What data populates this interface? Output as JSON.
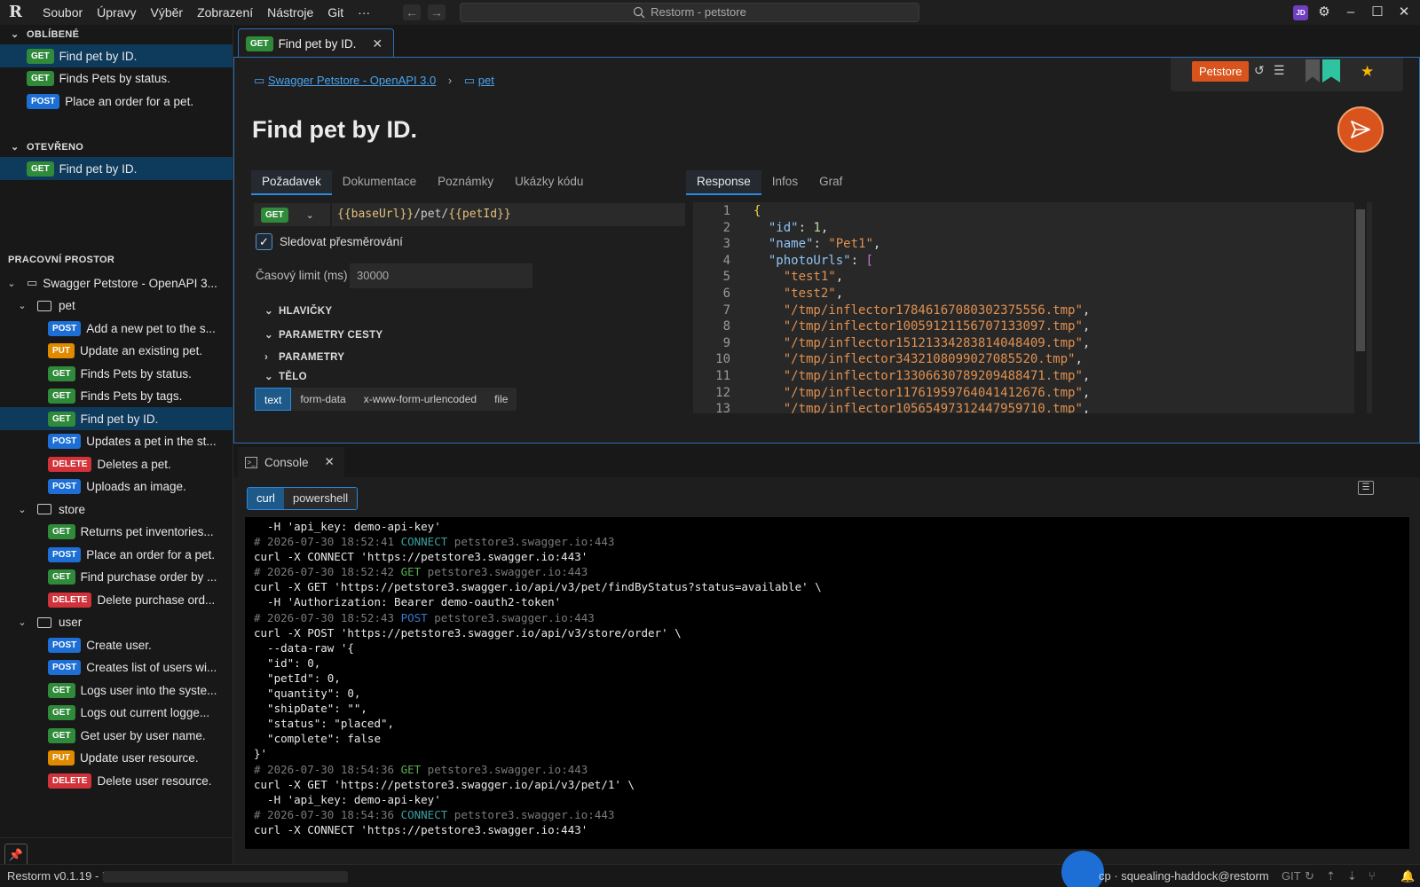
{
  "app": {
    "title": "Restorm - petstore",
    "menu": [
      "Soubor",
      "Úpravy",
      "Výběr",
      "Zobrazení",
      "Nástroje",
      "Git",
      "···"
    ],
    "avatar": "JD"
  },
  "sidebar": {
    "favorites": {
      "title": "OBLÍBENÉ",
      "items": [
        {
          "method": "GET",
          "label": "Find pet by ID.",
          "selected": true
        },
        {
          "method": "GET",
          "label": "Finds Pets by status."
        },
        {
          "method": "POST",
          "label": "Place an order for a pet."
        }
      ]
    },
    "open": {
      "title": "OTEVŘENO",
      "items": [
        {
          "method": "GET",
          "label": "Find pet by ID.",
          "selected": true
        }
      ]
    },
    "workspace": {
      "title": "PRACOVNÍ PROSTOR",
      "root": "Swagger Petstore - OpenAPI 3...",
      "folders": [
        {
          "name": "pet",
          "items": [
            {
              "method": "POST",
              "label": "Add a new pet to the s..."
            },
            {
              "method": "PUT",
              "label": "Update an existing pet."
            },
            {
              "method": "GET",
              "label": "Finds Pets by status."
            },
            {
              "method": "GET",
              "label": "Finds Pets by tags."
            },
            {
              "method": "GET",
              "label": "Find pet by ID.",
              "selected": true
            },
            {
              "method": "POST",
              "label": "Updates a pet in the st..."
            },
            {
              "method": "DELETE",
              "label": "Deletes a pet."
            },
            {
              "method": "POST",
              "label": "Uploads an image."
            }
          ]
        },
        {
          "name": "store",
          "items": [
            {
              "method": "GET",
              "label": "Returns pet inventories..."
            },
            {
              "method": "POST",
              "label": "Place an order for a pet."
            },
            {
              "method": "GET",
              "label": "Find purchase order by ..."
            },
            {
              "method": "DELETE",
              "label": "Delete purchase ord..."
            }
          ]
        },
        {
          "name": "user",
          "items": [
            {
              "method": "POST",
              "label": "Create user."
            },
            {
              "method": "POST",
              "label": "Creates list of users wi..."
            },
            {
              "method": "GET",
              "label": "Logs user into the syste..."
            },
            {
              "method": "GET",
              "label": "Logs out current logge..."
            },
            {
              "method": "GET",
              "label": "Get user by user name."
            },
            {
              "method": "PUT",
              "label": "Update user resource."
            },
            {
              "method": "DELETE",
              "label": "Delete user resource."
            }
          ]
        }
      ]
    }
  },
  "editor": {
    "tab": {
      "method": "GET",
      "label": "Find pet by ID."
    },
    "breadcrumb": {
      "collection": "Swagger Petstore - OpenAPI 3.0",
      "folder": "pet"
    },
    "workspace_badge": "Petstore",
    "title": "Find pet by ID.",
    "request_tabs": [
      "Požadavek",
      "Dokumentace",
      "Poznámky",
      "Ukázky kódu"
    ],
    "response_tabs": [
      "Response",
      "Infos",
      "Graf"
    ],
    "method": "GET",
    "url": {
      "p1": "{{baseUrl}}",
      "p2": "/pet/",
      "p3": "{{petId}}"
    },
    "follow_redirects": "Sledovat přesměrování",
    "timeout_label": "Časový limit (ms)",
    "timeout_placeholder": "30000",
    "sections": [
      "HLAVIČKY",
      "PARAMETRY CESTY",
      "PARAMETRY",
      "TĚLO"
    ],
    "body_types": [
      "text",
      "form-data",
      "x-www-form-urlencoded",
      "file"
    ]
  },
  "response": {
    "id": "1",
    "name": "\"Pet1\"",
    "photo_urls": [
      "\"test1\"",
      "\"test2\"",
      "\"/tmp/inflector17846167080302375556.tmp\"",
      "\"/tmp/inflector10059121156707133097.tmp\"",
      "\"/tmp/inflector15121334283814048409.tmp\"",
      "\"/tmp/inflector3432108099027085520.tmp\"",
      "\"/tmp/inflector13306630789209488471.tmp\"",
      "\"/tmp/inflector11761959764041412676.tmp\"",
      "\"/tmp/inflector10565497312447959710.tmp\""
    ]
  },
  "console": {
    "tab": "Console",
    "shells": [
      "curl",
      "powershell"
    ],
    "lines": [
      {
        "t": "  -H 'api_key: demo-api-key'"
      },
      {
        "c": "# 2026-07-30 18:52:41 ",
        "v": "CONNECT",
        "vc": "cv",
        "h": " petstore3.swagger.io:443"
      },
      {
        "t": "curl -X CONNECT 'https://petstore3.swagger.io:443'"
      },
      {
        "c": "# 2026-07-30 18:52:42 ",
        "v": "GET",
        "vc": "gv",
        "h": " petstore3.swagger.io:443"
      },
      {
        "t": "curl -X GET 'https://petstore3.swagger.io/api/v3/pet/findByStatus?status=available' \\"
      },
      {
        "t": "  -H 'Authorization: Bearer demo-oauth2-token'"
      },
      {
        "c": "# 2026-07-30 18:52:43 ",
        "v": "POST",
        "vc": "bv",
        "h": " petstore3.swagger.io:443"
      },
      {
        "t": "curl -X POST 'https://petstore3.swagger.io/api/v3/store/order' \\"
      },
      {
        "t": "  --data-raw '{"
      },
      {
        "t": "  \"id\": 0,"
      },
      {
        "t": "  \"petId\": 0,"
      },
      {
        "t": "  \"quantity\": 0,"
      },
      {
        "t": "  \"shipDate\": \"\","
      },
      {
        "t": "  \"status\": \"placed\","
      },
      {
        "t": "  \"complete\": false"
      },
      {
        "t": "}'"
      },
      {
        "c": "# 2026-07-30 18:54:36 ",
        "v": "GET",
        "vc": "gv",
        "h": " petstore3.swagger.io:443"
      },
      {
        "t": "curl -X GET 'https://petstore3.swagger.io/api/v3/pet/1' \\"
      },
      {
        "t": "  -H 'api_key: demo-api-key'"
      },
      {
        "c": "# 2026-07-30 18:54:36 ",
        "v": "CONNECT",
        "vc": "cv",
        "h": " petstore3.swagger.io:443"
      },
      {
        "t": "curl -X CONNECT 'https://petstore3.swagger.io:443'"
      }
    ]
  },
  "status": {
    "version": "Restorm v0.1.19 - Pro",
    "user": "cp · squealing-haddock@restorm",
    "git": "GIT"
  },
  "colors": {
    "accent": "#2d88e0",
    "brand": "#d9541c",
    "get": "#2f8a3a",
    "post": "#1d6fd6",
    "put": "#e08a00",
    "delete": "#d2333b"
  }
}
